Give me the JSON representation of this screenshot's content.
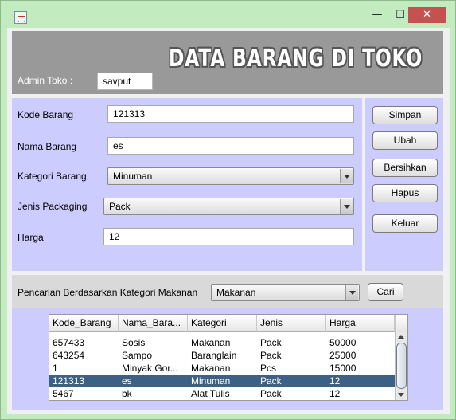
{
  "window": {
    "minimize_glyph": "—",
    "maximize_glyph": "☐",
    "close_glyph": "✕"
  },
  "header": {
    "title": "DATA BARANG DI TOKO",
    "admin_label": "Admin Toko :",
    "admin_value": "savput"
  },
  "form": {
    "kode_label": "Kode Barang",
    "kode_value": "121313",
    "nama_label": "Nama Barang",
    "nama_value": "es",
    "kategori_label": "Kategori Barang",
    "kategori_value": "Minuman",
    "packaging_label": "Jenis Packaging",
    "packaging_value": "Pack",
    "harga_label": "Harga",
    "harga_value": "12"
  },
  "buttons": {
    "simpan": "Simpan",
    "ubah": "Ubah",
    "bersihkan": "Bersihkan",
    "hapus": "Hapus",
    "keluar": "Keluar"
  },
  "search": {
    "label": "Pencarian Berdasarkan Kategori Makanan",
    "category_value": "Makanan",
    "cari_button": "Cari"
  },
  "table": {
    "columns": [
      "Kode_Barang",
      "Nama_Bara...",
      "Kategori",
      "Jenis",
      "Harga"
    ],
    "rows": [
      [
        "657433",
        "Sosis",
        "Makanan",
        "Pack",
        "50000"
      ],
      [
        "643254",
        "Sampo",
        "Baranglain",
        "Pack",
        "25000"
      ],
      [
        "1",
        "Minyak Gor...",
        "Makanan",
        "Pcs",
        "15000"
      ],
      [
        "121313",
        "es",
        "Minuman",
        "Pack",
        "12"
      ],
      [
        "5467",
        "bk",
        "Alat Tulis",
        "Pack",
        "12"
      ]
    ],
    "selected_row": 3
  },
  "colors": {
    "form_background": "#ccccff",
    "header_background": "#999999",
    "selection": "#3d6185",
    "close_button": "#c75050"
  }
}
